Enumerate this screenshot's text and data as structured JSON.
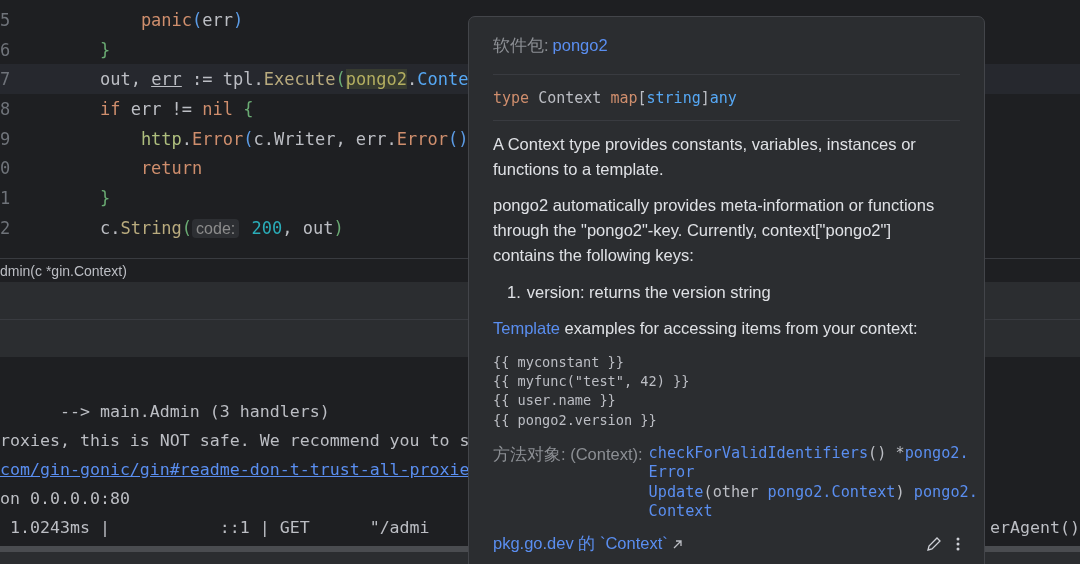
{
  "editor": {
    "lines": [
      {
        "number": "5",
        "current": false,
        "tokens": [
          {
            "text": "        panic",
            "kind": "builtin"
          },
          {
            "text": "(",
            "kind": "paren-blue"
          },
          {
            "text": "err",
            "kind": "plain"
          },
          {
            "text": ")",
            "kind": "paren-blue"
          }
        ]
      },
      {
        "number": "6",
        "current": false,
        "tokens": [
          {
            "text": "    }",
            "kind": "paren-green"
          }
        ]
      },
      {
        "number": "7",
        "current": true,
        "tokens": [
          {
            "text": "    out, ",
            "kind": "plain"
          },
          {
            "text": "err",
            "kind": "underlined"
          },
          {
            "text": " := tpl.",
            "kind": "plain"
          },
          {
            "text": "Execute",
            "kind": "method"
          },
          {
            "text": "(",
            "kind": "paren-green"
          },
          {
            "text": "pongo2",
            "kind": "highlighted"
          },
          {
            "text": ".",
            "kind": "plain"
          },
          {
            "text": "Conte",
            "kind": "type"
          }
        ]
      },
      {
        "number": "8",
        "current": false,
        "tokens": [
          {
            "text": "    if",
            "kind": "keyword"
          },
          {
            "text": " err != ",
            "kind": "plain"
          },
          {
            "text": "nil",
            "kind": "keyword"
          },
          {
            "text": " {",
            "kind": "paren-green"
          }
        ]
      },
      {
        "number": "9",
        "current": false,
        "tokens": [
          {
            "text": "        http",
            "kind": "package"
          },
          {
            "text": ".",
            "kind": "plain"
          },
          {
            "text": "Error",
            "kind": "builtin"
          },
          {
            "text": "(",
            "kind": "paren-blue"
          },
          {
            "text": "c.Writer, err.",
            "kind": "plain"
          },
          {
            "text": "Error",
            "kind": "builtin"
          },
          {
            "text": "()",
            "kind": "paren-blue"
          }
        ]
      },
      {
        "number": "0",
        "current": false,
        "tokens": [
          {
            "text": "        return",
            "kind": "keyword"
          }
        ]
      },
      {
        "number": "1",
        "current": false,
        "tokens": [
          {
            "text": "    }",
            "kind": "paren-green"
          }
        ]
      },
      {
        "number": "2",
        "current": false,
        "tokens": [
          {
            "text": "    c.",
            "kind": "plain"
          },
          {
            "text": "String",
            "kind": "method"
          },
          {
            "text": "(",
            "kind": "paren-green"
          },
          {
            "text": "code:",
            "kind": "hint"
          },
          {
            "text": " 200",
            "kind": "number"
          },
          {
            "text": ", out",
            "kind": "plain"
          },
          {
            "text": ")",
            "kind": "paren-green"
          }
        ]
      }
    ]
  },
  "breadcrumb": "dmin(c *gin.Context)",
  "terminal": {
    "lines": [
      {
        "text": "      --> main.Admin (3 handlers)",
        "link": false
      },
      {
        "text": "roxies, this is NOT safe. We recommend you to s",
        "link": false
      },
      {
        "text": "com/gin-gonic/gin#readme-don-t-trust-all-proxie",
        "link": true
      },
      {
        "text": "on 0.0.0.0:80",
        "link": false
      },
      {
        "text": " 1.0243ms |           ::1 | GET      \"/admi",
        "link": false
      }
    ],
    "right_text": "erAgent()"
  },
  "popup": {
    "package_label": "软件包:",
    "package_name": "pongo2",
    "signature": [
      {
        "text": "type",
        "kind": "keyword"
      },
      {
        "text": " Context ",
        "kind": "plain"
      },
      {
        "text": "map",
        "kind": "keyword"
      },
      {
        "text": "[",
        "kind": "plain"
      },
      {
        "text": "string",
        "kind": "type"
      },
      {
        "text": "]",
        "kind": "plain"
      },
      {
        "text": "any",
        "kind": "type"
      }
    ],
    "paragraphs": [
      "A Context type provides constants, variables, instances or functions to a template.",
      "pongo2 automatically provides meta-information or functions through the \"pongo2\"-key. Currently, context[\"pongo2\"] contains the following keys:"
    ],
    "list": [
      {
        "marker": "1.",
        "text": "version: returns the version string"
      }
    ],
    "template_link": "Template",
    "template_text": " examples for accessing items from your context:",
    "examples": [
      "{{ myconstant }}",
      "{{ myfunc(\"test\", 42) }}",
      "{{ user.name }}",
      "{{ pongo2.version }}"
    ],
    "methods_label": "方法对象: (Context):",
    "methods": [
      {
        "lines": [
          [
            {
              "text": "checkForValidIdentifiers",
              "kind": "link"
            },
            {
              "text": "() *",
              "kind": "plain"
            },
            {
              "text": "pongo2.",
              "kind": "link"
            }
          ],
          [
            {
              "text": "Error",
              "kind": "link"
            }
          ]
        ]
      },
      {
        "lines": [
          [
            {
              "text": "Update",
              "kind": "link"
            },
            {
              "text": "(other ",
              "kind": "plain"
            },
            {
              "text": "pongo2.Context",
              "kind": "link"
            },
            {
              "text": ") ",
              "kind": "plain"
            },
            {
              "text": "pongo2.",
              "kind": "link"
            }
          ],
          [
            {
              "text": "Context",
              "kind": "link"
            }
          ]
        ]
      }
    ],
    "doc_link": "pkg.go.dev 的 `Context`"
  }
}
